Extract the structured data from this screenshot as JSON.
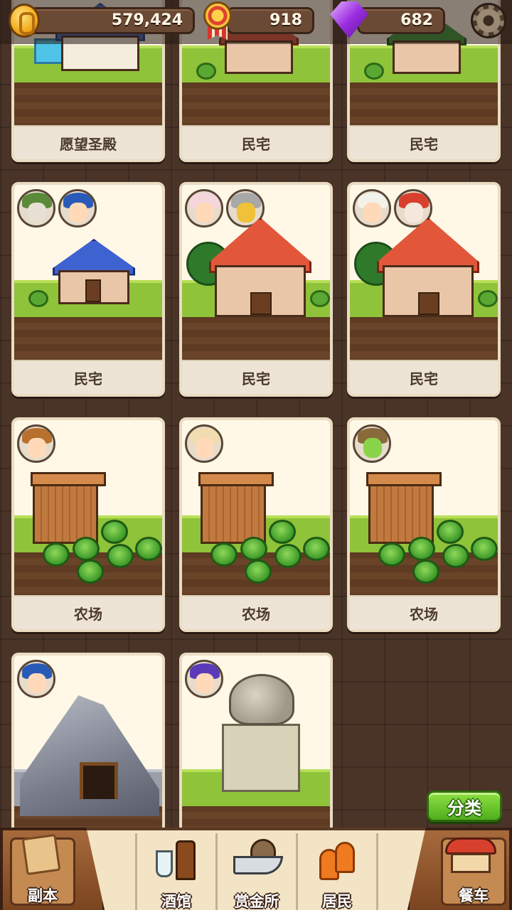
{
  "resources": {
    "gold": "579,424",
    "medals": "918",
    "gems": "682"
  },
  "icons": {
    "gold": "gold-coin-icon",
    "medals": "medal-icon",
    "gems": "purple-gem-icon",
    "settings": "gear-icon"
  },
  "buildings": [
    {
      "name": "愿望圣殿",
      "type": "temple",
      "residents": 0
    },
    {
      "name": "民宅",
      "type": "house-red",
      "residents": 0
    },
    {
      "name": "民宅",
      "type": "house-green",
      "residents": 0
    },
    {
      "name": "民宅",
      "type": "house-blue",
      "residents": 2
    },
    {
      "name": "民宅",
      "type": "house-red",
      "residents": 2
    },
    {
      "name": "民宅",
      "type": "house-red",
      "residents": 2
    },
    {
      "name": "农场",
      "type": "farm",
      "residents": 1
    },
    {
      "name": "农场",
      "type": "farm",
      "residents": 1
    },
    {
      "name": "农场",
      "type": "farm",
      "residents": 1
    },
    {
      "name": "",
      "type": "mine",
      "residents": 1
    },
    {
      "name": "",
      "type": "altar",
      "residents": 1
    }
  ],
  "sort_button": "分类",
  "nav": {
    "dungeon": "副本",
    "tavern": "酒馆",
    "bounty": "赏金所",
    "residents": "居民",
    "food_truck": "餐车"
  },
  "colors": {
    "background": "#4a3428",
    "card": "#fff8e6",
    "grass": "#8ec33a",
    "sort_button": "#5fbf24",
    "nav_bg": "#f4e4c6"
  }
}
